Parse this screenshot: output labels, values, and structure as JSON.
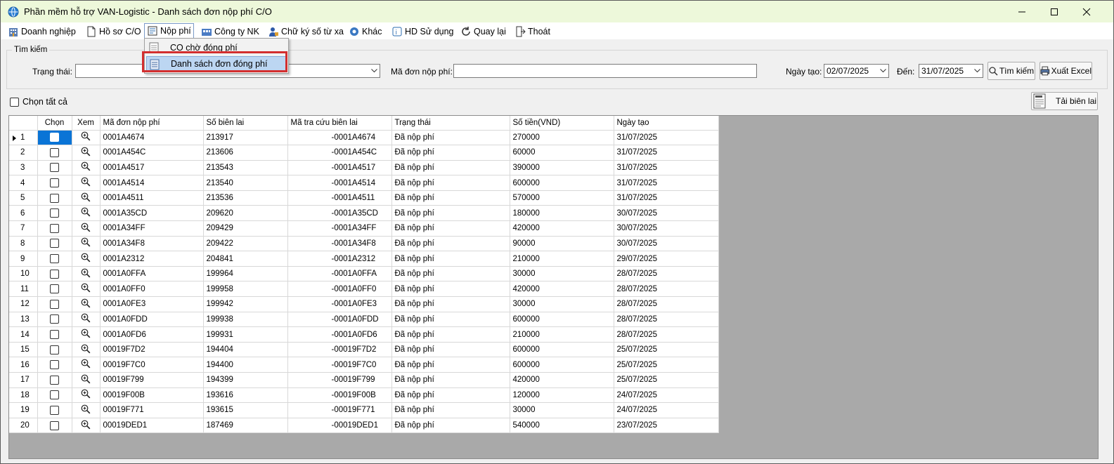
{
  "window": {
    "title": "Phần mềm hỗ trợ VAN-Logistic - Danh sách đơn nộp phí C/O"
  },
  "menu": {
    "items": [
      {
        "label": "Doanh nghiệp",
        "icon": "building-icon"
      },
      {
        "label": "Hồ sơ C/O",
        "icon": "document-icon"
      },
      {
        "label": "Nộp phí",
        "icon": "payment-icon"
      },
      {
        "label": "Công ty NK",
        "icon": "company-icon"
      },
      {
        "label": "Chữ ký số từ xa",
        "icon": "user-key-icon"
      },
      {
        "label": "Khác",
        "icon": "gear-icon"
      },
      {
        "label": "HD Sử dụng",
        "icon": "help-doc-icon"
      },
      {
        "label": "Quay lại",
        "icon": "refresh-icon"
      },
      {
        "label": "Thoát",
        "icon": "exit-icon"
      }
    ],
    "dropdown": [
      {
        "label": "CO chờ đóng phí"
      },
      {
        "label": "Danh sách đơn đóng phí"
      }
    ]
  },
  "search": {
    "group_title": "Tìm kiếm",
    "status_label": "Trạng thái:",
    "status_value": "",
    "code_label": "Mã đơn nộp phí:",
    "code_value": "",
    "date_label": "Ngày tạo:",
    "date_from": "02/07/2025",
    "to_label": "Đến:",
    "date_to": "31/07/2025",
    "search_button": "Tìm kiếm",
    "export_button": "Xuất Excel"
  },
  "select_all_label": "Chọn tất cả",
  "reload_button": "Tải biên lai",
  "table": {
    "columns": [
      "",
      "Chọn",
      "Xem",
      "Mã đơn nộp phí",
      "Số biên lai",
      "Mã tra cứu biên lai",
      "Trạng thái",
      "Số tiền(VND)",
      "Ngày tạo"
    ],
    "rows": [
      [
        "1",
        "0001A4674",
        "213917",
        "-0001A4674",
        "Đã nộp phí",
        "270000",
        "31/07/2025"
      ],
      [
        "2",
        "0001A454C",
        "213606",
        "-0001A454C",
        "Đã nộp phí",
        "60000",
        "31/07/2025"
      ],
      [
        "3",
        "0001A4517",
        "213543",
        "-0001A4517",
        "Đã nộp phí",
        "390000",
        "31/07/2025"
      ],
      [
        "4",
        "0001A4514",
        "213540",
        "-0001A4514",
        "Đã nộp phí",
        "600000",
        "31/07/2025"
      ],
      [
        "5",
        "0001A4511",
        "213536",
        "-0001A4511",
        "Đã nộp phí",
        "570000",
        "31/07/2025"
      ],
      [
        "6",
        "0001A35CD",
        "209620",
        "-0001A35CD",
        "Đã nộp phí",
        "180000",
        "30/07/2025"
      ],
      [
        "7",
        "0001A34FF",
        "209429",
        "-0001A34FF",
        "Đã nộp phí",
        "420000",
        "30/07/2025"
      ],
      [
        "8",
        "0001A34F8",
        "209422",
        "-0001A34F8",
        "Đã nộp phí",
        "90000",
        "30/07/2025"
      ],
      [
        "9",
        "0001A2312",
        "204841",
        "-0001A2312",
        "Đã nộp phí",
        "210000",
        "29/07/2025"
      ],
      [
        "10",
        "0001A0FFA",
        "199964",
        "-0001A0FFA",
        "Đã nộp phí",
        "30000",
        "28/07/2025"
      ],
      [
        "11",
        "0001A0FF0",
        "199958",
        "-0001A0FF0",
        "Đã nộp phí",
        "420000",
        "28/07/2025"
      ],
      [
        "12",
        "0001A0FE3",
        "199942",
        "-0001A0FE3",
        "Đã nộp phí",
        "30000",
        "28/07/2025"
      ],
      [
        "13",
        "0001A0FDD",
        "199938",
        "-0001A0FDD",
        "Đã nộp phí",
        "600000",
        "28/07/2025"
      ],
      [
        "14",
        "0001A0FD6",
        "199931",
        "-0001A0FD6",
        "Đã nộp phí",
        "210000",
        "28/07/2025"
      ],
      [
        "15",
        "00019F7D2",
        "194404",
        "-00019F7D2",
        "Đã nộp phí",
        "600000",
        "25/07/2025"
      ],
      [
        "16",
        "00019F7C0",
        "194400",
        "-00019F7C0",
        "Đã nộp phí",
        "600000",
        "25/07/2025"
      ],
      [
        "17",
        "00019F799",
        "194399",
        "-00019F799",
        "Đã nộp phí",
        "420000",
        "25/07/2025"
      ],
      [
        "18",
        "00019F00B",
        "193616",
        "-00019F00B",
        "Đã nộp phí",
        "120000",
        "24/07/2025"
      ],
      [
        "19",
        "00019F771",
        "193615",
        "-00019F771",
        "Đã nộp phí",
        "30000",
        "24/07/2025"
      ],
      [
        "20",
        "00019DED1",
        "187469",
        "-00019DED1",
        "Đã nộp phí",
        "540000",
        "23/07/2025"
      ]
    ]
  },
  "colors": {
    "title_bar": "#edf8da",
    "selection": "#0a74d6",
    "highlight_box": "#d32f2f",
    "grid_background": "#a9a9a9"
  }
}
